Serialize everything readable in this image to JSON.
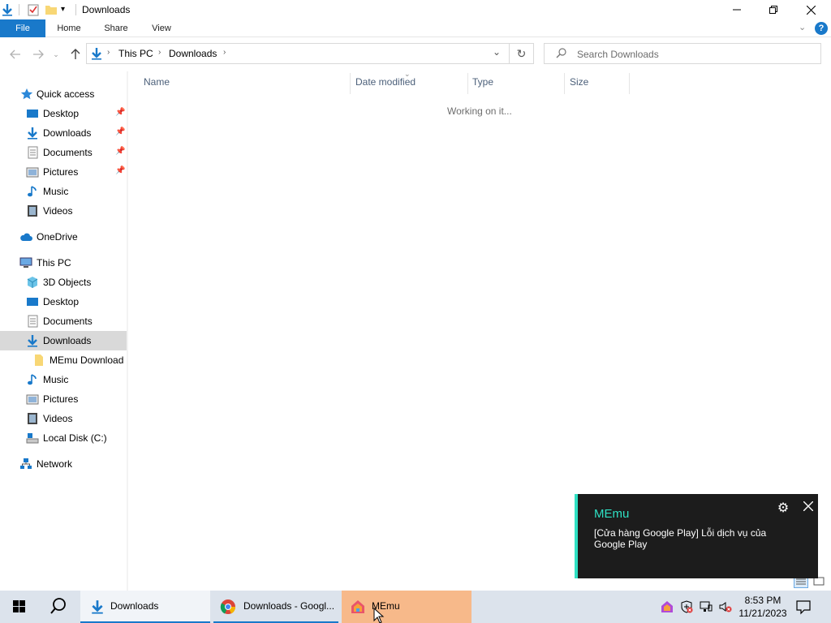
{
  "window": {
    "title": "Downloads"
  },
  "ribbon": {
    "tabs": [
      "File",
      "Home",
      "Share",
      "View"
    ]
  },
  "address": {
    "crumbs": [
      "This PC",
      "Downloads"
    ],
    "search_placeholder": "Search Downloads"
  },
  "nav": {
    "quick_access": "Quick access",
    "qa_items": [
      "Desktop",
      "Downloads",
      "Documents",
      "Pictures",
      "Music",
      "Videos"
    ],
    "onedrive": "OneDrive",
    "this_pc": "This PC",
    "pc_items": [
      "3D Objects",
      "Desktop",
      "Documents",
      "Downloads",
      "MEmu Download",
      "Music",
      "Pictures",
      "Videos",
      "Local Disk (C:)"
    ],
    "network": "Network"
  },
  "filelist": {
    "columns": [
      "Name",
      "Date modified",
      "Type",
      "Size"
    ],
    "status": "Working on it..."
  },
  "toast": {
    "title": "MEmu",
    "body": "[Cửa hàng Google Play] Lỗi dịch vụ của Google Play"
  },
  "taskbar": {
    "apps": [
      "Downloads",
      "Downloads - Googl...",
      "MEmu"
    ],
    "time": "8:53 PM",
    "date": "11/21/2023"
  },
  "colors": {
    "accent": "#1979ca",
    "toast_accent": "#2fe0c3",
    "taskbar": "#dce3ec",
    "memu_highlight": "#f7b98a"
  }
}
